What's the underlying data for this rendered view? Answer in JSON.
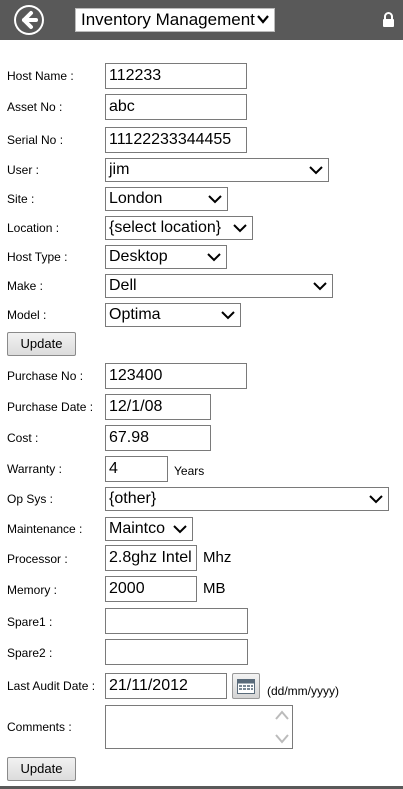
{
  "header": {
    "module_select": "Inventory Management"
  },
  "host": {
    "host_name": {
      "label": "Host Name :",
      "value": "112233"
    },
    "asset_no": {
      "label": "Asset No :",
      "value": "abc"
    },
    "serial_no": {
      "label": "Serial No :",
      "value": "11122233344455"
    },
    "user": {
      "label": "User :",
      "value": "jim"
    },
    "site": {
      "label": "Site :",
      "value": "London"
    },
    "location": {
      "label": "Location :",
      "value": "{select location}"
    },
    "host_type": {
      "label": "Host Type :",
      "value": "Desktop"
    },
    "make": {
      "label": "Make :",
      "value": "Dell"
    },
    "model": {
      "label": "Model :",
      "value": "Optima"
    },
    "update_label": "Update"
  },
  "purchase": {
    "purchase_no": {
      "label": "Purchase No :",
      "value": "123400"
    },
    "purchase_date": {
      "label": "Purchase Date :",
      "value": "12/1/08"
    },
    "cost": {
      "label": "Cost :",
      "value": "67.98"
    },
    "warranty": {
      "label": "Warranty :",
      "value": "4",
      "unit": "Years"
    },
    "op_sys": {
      "label": "Op Sys :",
      "value": "{other}"
    },
    "maintenance": {
      "label": "Maintenance :",
      "value": "Maintco"
    },
    "processor": {
      "label": "Processor :",
      "value": "2.8ghz Intel",
      "unit": "Mhz"
    },
    "memory": {
      "label": "Memory :",
      "value": "2000",
      "unit": "MB"
    },
    "spare1": {
      "label": "Spare1 :",
      "value": ""
    },
    "spare2": {
      "label": "Spare2 :",
      "value": ""
    },
    "last_audit_date": {
      "label": "Last Audit Date :",
      "value": "21/11/2012",
      "format_hint": "(dd/mm/yyyy)"
    },
    "comments": {
      "label": "Comments :",
      "value": ""
    },
    "update_label": "Update"
  },
  "icons": {
    "back": "back-arrow-icon",
    "lock": "lock-icon",
    "calendar": "calendar-icon"
  },
  "colors": {
    "topbar": "#595959"
  }
}
